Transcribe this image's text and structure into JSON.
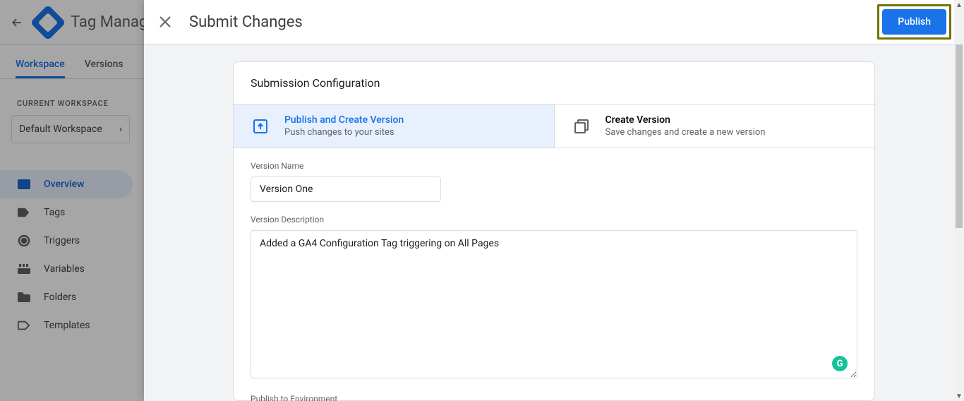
{
  "app": {
    "title": "Tag Manager"
  },
  "tabs": {
    "workspace": "Workspace",
    "versions": "Versions"
  },
  "sidebar": {
    "current_label": "CURRENT WORKSPACE",
    "workspace_name": "Default Workspace",
    "items": [
      {
        "label": "Overview"
      },
      {
        "label": "Tags"
      },
      {
        "label": "Triggers"
      },
      {
        "label": "Variables"
      },
      {
        "label": "Folders"
      },
      {
        "label": "Templates"
      }
    ]
  },
  "modal": {
    "title": "Submit Changes",
    "publish_btn": "Publish"
  },
  "config": {
    "heading": "Submission Configuration",
    "options": [
      {
        "title": "Publish and Create Version",
        "sub": "Push changes to your sites"
      },
      {
        "title": "Create Version",
        "sub": "Save changes and create a new version"
      }
    ],
    "version_name_label": "Version Name",
    "version_name_value": "Version One",
    "version_desc_label": "Version Description",
    "version_desc_value": "Added a GA4 Configuration Tag triggering on All Pages",
    "publish_env_label": "Publish to Environment"
  }
}
